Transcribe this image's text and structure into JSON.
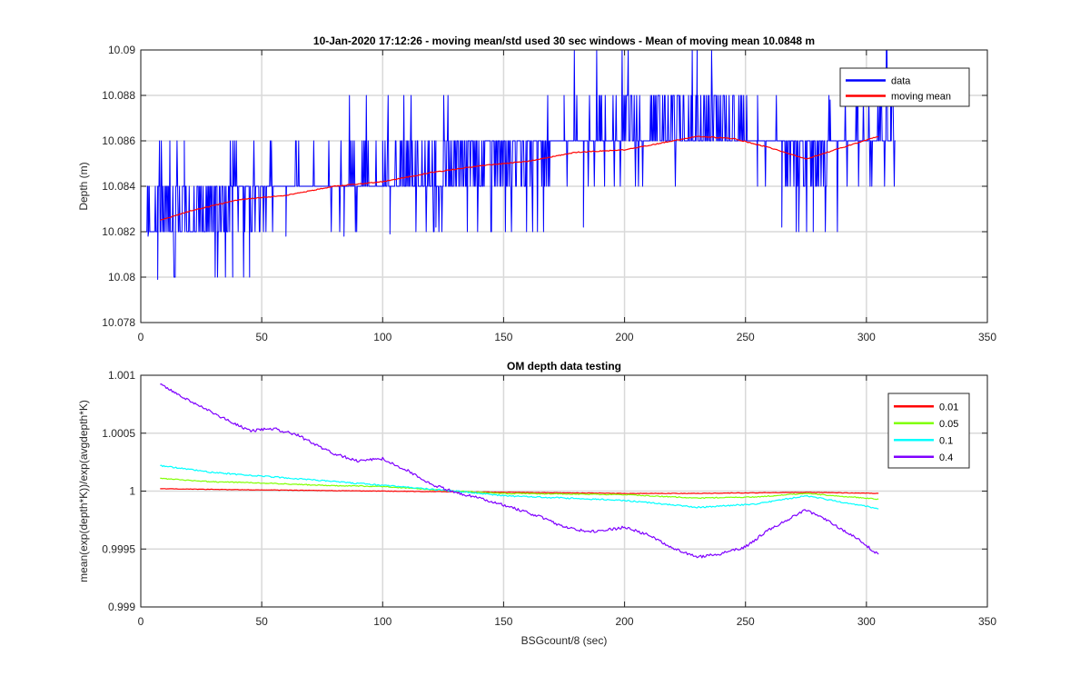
{
  "chart_data": [
    {
      "type": "line",
      "title": "10-Jan-2020 17:12:26 - moving mean/std used 30 sec windows - Mean of moving mean 10.0848 m",
      "xlabel": "",
      "ylabel": "Depth (m)",
      "xlim": [
        0,
        350
      ],
      "ylim": [
        10.078,
        10.09
      ],
      "xticks": [
        "0",
        "50",
        "100",
        "150",
        "200",
        "250",
        "300",
        "350"
      ],
      "yticks": [
        "10.078",
        "10.08",
        "10.082",
        "10.084",
        "10.086",
        "10.088",
        "10.09"
      ],
      "grid": true,
      "legend_position": "top-right",
      "series": [
        {
          "name": "data",
          "color": "#0000ff",
          "style": "noisy",
          "quantum": 0.002,
          "x_range": [
            2,
            312
          ],
          "base_levels": [
            [
              2,
              10.0825
            ],
            [
              15,
              10.083
            ],
            [
              40,
              10.0835
            ],
            [
              70,
              10.084
            ],
            [
              100,
              10.0843
            ],
            [
              130,
              10.0848
            ],
            [
              160,
              10.0852
            ],
            [
              175,
              10.086
            ],
            [
              200,
              10.0865
            ],
            [
              240,
              10.0868
            ],
            [
              260,
              10.086
            ],
            [
              275,
              10.0852
            ],
            [
              290,
              10.086
            ],
            [
              312,
              10.0868
            ]
          ],
          "spikes": [
            [
              7,
              10.0799
            ],
            [
              3,
              10.0818
            ],
            [
              45,
              10.0818
            ],
            [
              60,
              10.0818
            ],
            [
              84,
              10.0818
            ],
            [
              103,
              10.0819
            ],
            [
              122,
              10.0822
            ],
            [
              183,
              10.0822
            ],
            [
              265,
              10.0822
            ],
            [
              272,
              10.082
            ],
            [
              278,
              10.082
            ],
            [
              18,
              10.086
            ],
            [
              38,
              10.086
            ],
            [
              100,
              10.086
            ],
            [
              175,
              10.088
            ],
            [
              190,
              10.088
            ],
            [
              230,
              10.088
            ],
            [
              255,
              10.088
            ],
            [
              285,
              10.0878
            ],
            [
              310,
              10.0878
            ]
          ]
        },
        {
          "name": "moving mean",
          "color": "#ff0000",
          "x": [
            8,
            20,
            40,
            60,
            80,
            100,
            120,
            140,
            160,
            180,
            200,
            215,
            230,
            245,
            260,
            275,
            290,
            305
          ],
          "y": [
            10.0825,
            10.0829,
            10.0834,
            10.0836,
            10.084,
            10.0842,
            10.0846,
            10.0849,
            10.0851,
            10.0855,
            10.0856,
            10.0859,
            10.0862,
            10.0861,
            10.0857,
            10.0852,
            10.0857,
            10.0862
          ]
        }
      ]
    },
    {
      "type": "line",
      "title": "OM depth data testing",
      "xlabel": "BSGcount/8 (sec)",
      "ylabel": "mean(exp(depth*K))/exp(avgdepth*K)",
      "xlim": [
        0,
        350
      ],
      "ylim": [
        0.999,
        1.001
      ],
      "xticks": [
        "0",
        "50",
        "100",
        "150",
        "200",
        "250",
        "300",
        "350"
      ],
      "yticks": [
        "0.999",
        "0.9995",
        "1",
        "1.0005",
        "1.001"
      ],
      "grid": true,
      "legend_position": "top-right",
      "series": [
        {
          "name": "0.01",
          "color": "#ff0000",
          "noise": 2e-06,
          "x": [
            8,
            50,
            100,
            150,
            200,
            230,
            275,
            305
          ],
          "y": [
            1.00002,
            1.00001,
            1.0,
            0.99999,
            0.99998,
            0.99998,
            0.99999,
            0.99998
          ]
        },
        {
          "name": "0.05",
          "color": "#80ff00",
          "noise": 4e-06,
          "x": [
            8,
            30,
            50,
            75,
            100,
            130,
            150,
            200,
            230,
            255,
            275,
            305
          ],
          "y": [
            1.00011,
            1.00008,
            1.00007,
            1.00005,
            1.00004,
            1.0,
            0.99998,
            0.99997,
            0.99994,
            0.99995,
            0.99998,
            0.99993
          ]
        },
        {
          "name": "0.1",
          "color": "#00ffff",
          "noise": 6e-06,
          "x": [
            8,
            30,
            50,
            75,
            100,
            130,
            150,
            200,
            230,
            255,
            275,
            305
          ],
          "y": [
            1.00022,
            1.00016,
            1.00013,
            1.00009,
            1.00005,
            1.0,
            0.99996,
            0.99992,
            0.99986,
            0.99989,
            0.99996,
            0.99985
          ]
        },
        {
          "name": "0.4",
          "color": "#7f00ff",
          "noise": 1.2e-05,
          "x": [
            8,
            20,
            35,
            45,
            55,
            65,
            80,
            90,
            100,
            110,
            120,
            130,
            140,
            150,
            165,
            175,
            185,
            195,
            200,
            210,
            220,
            230,
            240,
            250,
            260,
            275,
            285,
            295,
            305
          ],
          "y": [
            1.00092,
            1.00078,
            1.00062,
            1.00052,
            1.00054,
            1.00048,
            1.00032,
            1.00026,
            1.00028,
            1.00018,
            1.00006,
            0.99999,
            0.99994,
            0.99988,
            0.99978,
            0.99969,
            0.99965,
            0.99967,
            0.99969,
            0.99962,
            0.99951,
            0.99943,
            0.99946,
            0.99952,
            0.99967,
            0.99984,
            0.99973,
            0.99961,
            0.99945
          ]
        }
      ]
    }
  ]
}
